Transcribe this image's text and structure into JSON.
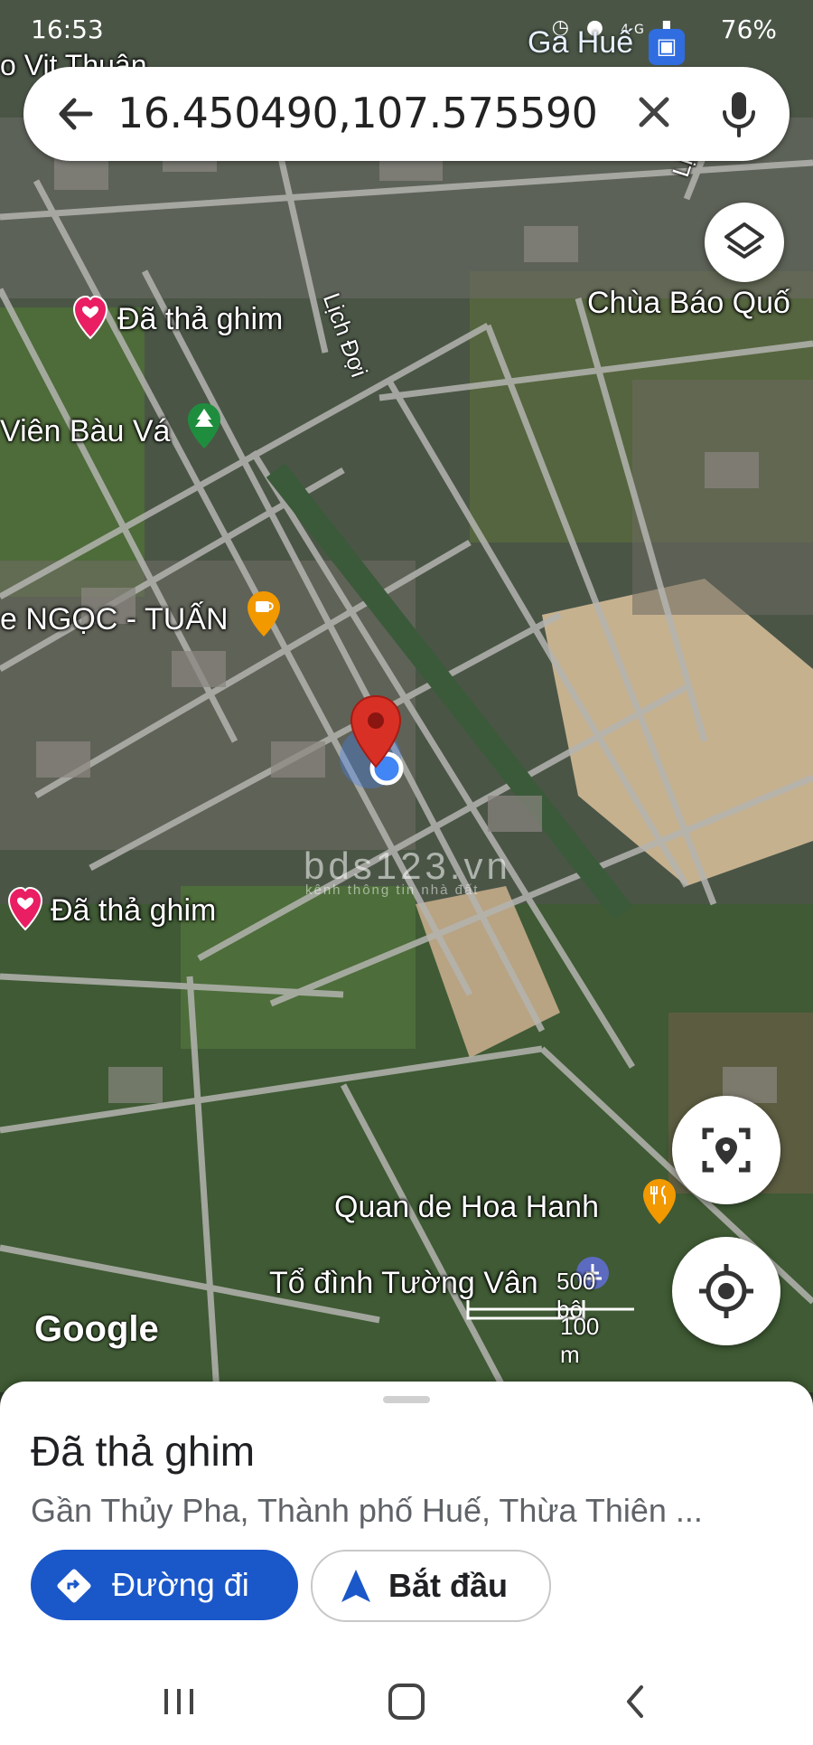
{
  "status_bar": {
    "time": "16:53",
    "battery": "76%",
    "network": "4G"
  },
  "search": {
    "query": "16.450490,107.575590"
  },
  "map": {
    "labels": {
      "ga_hue": "Ga Huế",
      "top_left_partial": "o Vit Thuận",
      "lich_doi_1": "Lịch Đợi",
      "lich_doi_2": "Lịch Đợi",
      "chua_bao_quoc": "Chùa Báo Quố",
      "pin_1": "Đã thả ghim",
      "pin_2": "Đã thả ghim",
      "vien_bau_va": "Viên Bàu Vá",
      "cafe_ngoc_tuan": "e NGỌC - TUẤN",
      "quan_de_hoa_hanh": "Quan de Hoa Hanh",
      "to_dinh_tuong_van": "Tổ đình Tường Vân"
    },
    "scale": {
      "feet": "500 bộ",
      "meters": "100 m"
    },
    "attribution": "Google",
    "watermark": {
      "main": "bds123.vn",
      "sub": "kênh thông tin nhà đất"
    }
  },
  "sheet": {
    "title": "Đã thả ghim",
    "address": "Gần Thủy Pha, Thành phố Huế, Thừa Thiên ...",
    "directions_label": "Đường đi",
    "start_label": "Bắt đầu"
  },
  "colors": {
    "accent": "#1a57c9",
    "pin_red": "#d93025",
    "location_blue": "#4285f4",
    "heart_pink": "#e91e63"
  }
}
